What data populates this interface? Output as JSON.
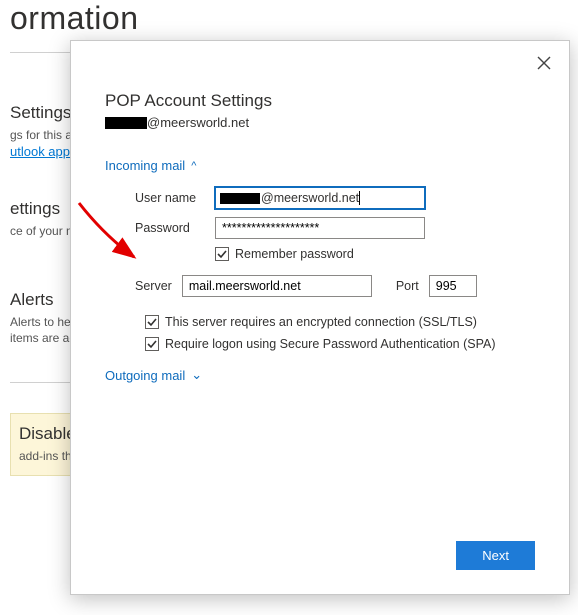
{
  "bg": {
    "heading": "ormation",
    "sections": {
      "s1_title": "Settings",
      "s1_desc": "gs for this ac",
      "s1_link": "utlook app f",
      "s2_title": "ettings",
      "s2_desc": "ce of your m",
      "s3_title": "Alerts",
      "s3_desc1": "Alerts to he",
      "s3_desc2": "items are ac",
      "s4_title": "Disable",
      "s4_desc": "add-ins tha"
    }
  },
  "dialog": {
    "title": "POP Account Settings",
    "email_suffix": "@meersworld.net",
    "incoming_label": "Incoming mail",
    "username_label": "User name",
    "username_suffix": "@meersworld.net",
    "password_label": "Password",
    "password_value": "********************",
    "remember_label": "Remember password",
    "server_label": "Server",
    "server_value": "mail.meersworld.net",
    "port_label": "Port",
    "port_value": "995",
    "ssl_label": "This server requires an encrypted connection (SSL/TLS)",
    "spa_label": "Require logon using Secure Password Authentication (SPA)",
    "outgoing_label": "Outgoing mail",
    "next_label": "Next"
  }
}
